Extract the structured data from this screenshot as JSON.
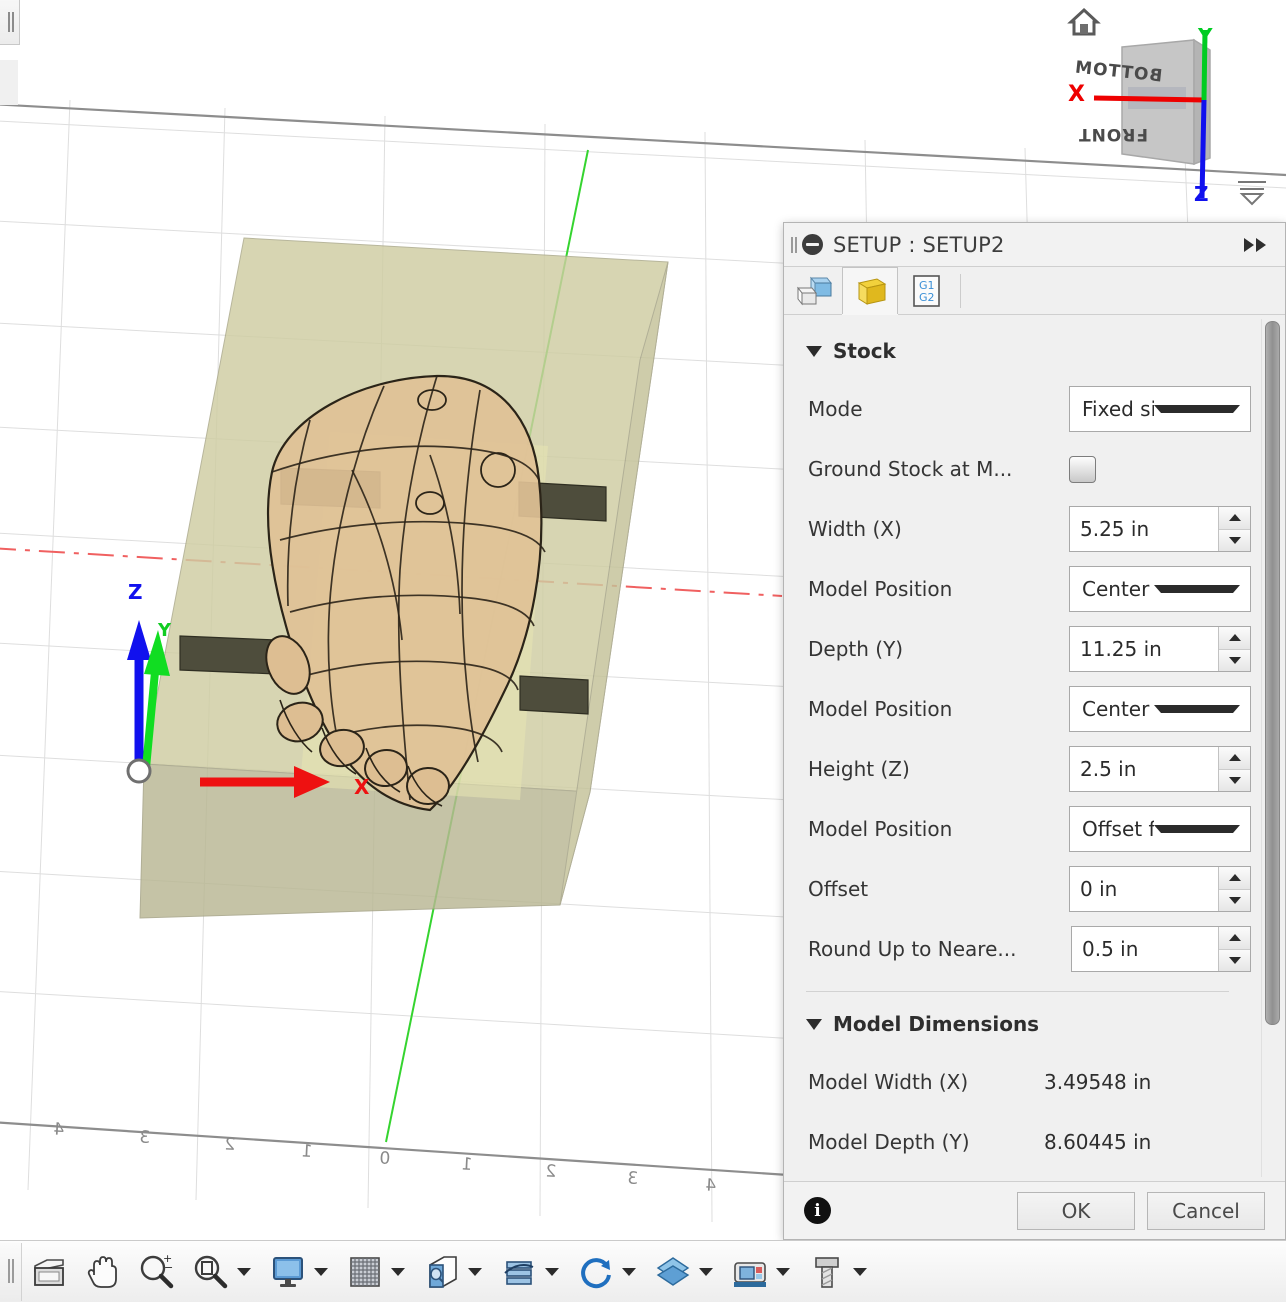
{
  "panel": {
    "title": "SETUP : SETUP2",
    "grip_icon": "drag-grip-icon",
    "status_icon": "suppress-icon",
    "collapse_icon": "double-chevron-right-icon",
    "tabs": [
      {
        "name": "setup",
        "icon": "setup-boxes-icon",
        "label": "Setup",
        "active": false
      },
      {
        "name": "stock",
        "icon": "stock-cube-icon",
        "label": "Stock",
        "active": true
      },
      {
        "name": "post-process",
        "icon": "gcode-g1g2-icon",
        "label": "Post Process",
        "active": false
      }
    ],
    "sections": [
      {
        "id": "stock",
        "heading": "Stock",
        "rows": [
          {
            "label": "Mode",
            "type": "combo",
            "value": "Fixed size b...",
            "name": "mode"
          },
          {
            "label": "Ground Stock at M...",
            "type": "checkbox",
            "value": "",
            "checked": false,
            "name": "ground-stock"
          },
          {
            "label": "Width (X)",
            "type": "spinner",
            "value": "5.25 in",
            "name": "width-x"
          },
          {
            "label": "Model Position",
            "type": "combo",
            "value": "Center",
            "name": "model-position-x"
          },
          {
            "label": "Depth (Y)",
            "type": "spinner",
            "value": "11.25 in",
            "name": "depth-y"
          },
          {
            "label": "Model Position",
            "type": "combo",
            "value": "Center",
            "name": "model-position-y"
          },
          {
            "label": "Height (Z)",
            "type": "spinner",
            "value": "2.5 in",
            "name": "height-z"
          },
          {
            "label": "Model Position",
            "type": "combo",
            "value": "Offset from...",
            "name": "model-position-z"
          },
          {
            "label": "Offset",
            "type": "spinner",
            "value": "0 in",
            "name": "offset"
          },
          {
            "label": "Round Up to Neare...",
            "type": "spinner",
            "value": "0.5 in",
            "name": "round-up"
          }
        ]
      },
      {
        "id": "model-dimensions",
        "heading": "Model Dimensions",
        "dims": [
          {
            "label": "Model Width (X)",
            "value": "3.49548 in",
            "name": "model-width-x"
          },
          {
            "label": "Model Depth (Y)",
            "value": "8.60445 in",
            "name": "model-depth-y"
          }
        ]
      }
    ],
    "footer": {
      "info_icon": "info-icon",
      "ok_label": "OK",
      "cancel_label": "Cancel"
    }
  },
  "viewcube": {
    "home_icon": "home-icon",
    "faces": [
      {
        "label": "BOTTOM"
      },
      {
        "label": "FRONT"
      }
    ],
    "axes": [
      {
        "label": "X",
        "color": "#ee0000"
      },
      {
        "label": "Y",
        "color": "#00cc22"
      },
      {
        "label": "Z",
        "color": "#1111ee"
      }
    ],
    "ground_icon": "ground-plane-icon"
  },
  "wcs": {
    "axes": [
      {
        "label": "Z",
        "color": "#1111ee"
      },
      {
        "label": "Y",
        "color": "#11dd22"
      },
      {
        "label": "X",
        "color": "#ee1111"
      }
    ]
  },
  "viewport": {
    "grid_tick_labels": [
      "4",
      "3",
      "2",
      "1",
      "0",
      "1",
      "2",
      "3",
      "4"
    ],
    "stock_color": "#cfcda2",
    "model_color": "#e0c196",
    "clamp_color": "#4e4d3c"
  },
  "toolbar": {
    "grip_icon": "drag-grip-icon",
    "items": [
      {
        "name": "view-browser",
        "icon": "view-panel-icon",
        "caret": false
      },
      {
        "name": "pan",
        "icon": "hand-pan-icon",
        "caret": false
      },
      {
        "name": "zoom",
        "icon": "zoom-magnifier-icon",
        "caret": false
      },
      {
        "name": "zoom-fit",
        "icon": "zoom-fit-icon",
        "caret": true
      },
      {
        "name": "display-settings",
        "icon": "monitor-display-icon",
        "caret": true
      },
      {
        "name": "grid-snaps",
        "icon": "grid-icon",
        "caret": true
      },
      {
        "name": "viewports",
        "icon": "viewport-cube-icon",
        "caret": true
      },
      {
        "name": "section-analysis",
        "icon": "layers-stack-icon",
        "caret": true
      },
      {
        "name": "refresh",
        "icon": "refresh-circle-icon",
        "caret": true
      },
      {
        "name": "stock-visibility",
        "icon": "stock-diamond-icon",
        "caret": true
      },
      {
        "name": "machine-simulation",
        "icon": "machine-icon",
        "caret": true
      },
      {
        "name": "tool-library",
        "icon": "tool-bolt-icon",
        "caret": true
      }
    ]
  }
}
